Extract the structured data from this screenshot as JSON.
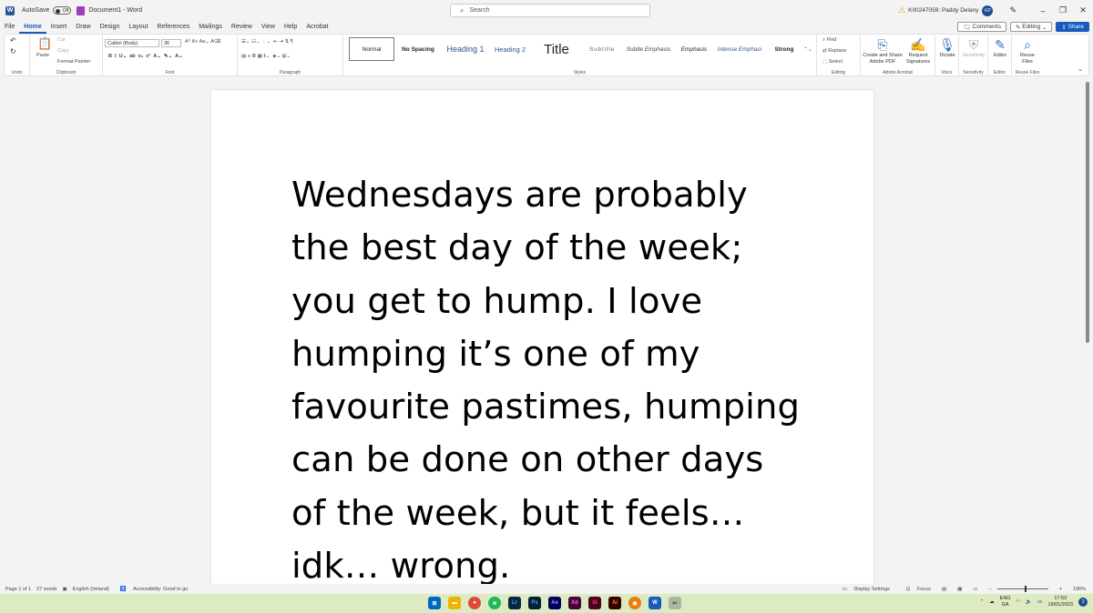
{
  "titlebar": {
    "app_logo": "W",
    "autosave_label": "AutoSave",
    "autosave_state": "Off",
    "doc_title": "Document1",
    "separator": "-",
    "app_name": "Word",
    "search_placeholder": "Search",
    "user": "K00247059: Paddy Delany",
    "avatar": "KP"
  },
  "menu": {
    "tabs": [
      "File",
      "Home",
      "Insert",
      "Draw",
      "Design",
      "Layout",
      "References",
      "Mailings",
      "Review",
      "View",
      "Help",
      "Acrobat"
    ],
    "active_tab": "Home",
    "comments": "Comments",
    "editing": "Editing",
    "share": "Share"
  },
  "ribbon": {
    "undo_label": "Undo",
    "clipboard": {
      "paste": "Paste",
      "cut": "Cut",
      "copy": "Copy",
      "format_painter": "Format Painter",
      "label": "Clipboard"
    },
    "font": {
      "family": "Calibri (Body)",
      "size": "36",
      "label": "Font"
    },
    "paragraph_label": "Paragraph",
    "styles": {
      "items": [
        "Normal",
        "No Spacing",
        "Heading 1",
        "Heading 2",
        "Title",
        "Subtitle",
        "Subtle Emphasis",
        "Emphasis",
        "Intense Emphasi",
        "Strong"
      ],
      "label": "Styles"
    },
    "editing": {
      "find": "Find",
      "replace": "Replace",
      "select": "Select",
      "label": "Editing"
    },
    "acrobat": {
      "create": "Create and Share Adobe PDF",
      "request": "Request Signatures",
      "label": "Adobe Acrobat"
    },
    "voice": {
      "dictate": "Dictate",
      "label": "Voice"
    },
    "sensitivity": {
      "btn": "Sensitivity",
      "label": "Sensitivity"
    },
    "editor": {
      "btn": "Editor",
      "label": "Editor"
    },
    "reuse": {
      "btn": "Reuse Files",
      "label": "Reuse Files"
    }
  },
  "document": {
    "body": "Wednesdays are probably the best day of the week; you get to hump. I love humping it’s one of my favourite pastimes, humping can be done on other days of the week, but it feels… idk… wrong."
  },
  "status": {
    "page": "Page 1 of 1",
    "words": "27 words",
    "language": "English (Ireland)",
    "accessibility": "Accessibility: Good to go",
    "display_settings": "Display Settings",
    "focus": "Focus",
    "zoom": "196%"
  },
  "taskbar": {
    "apps": [
      "Lr",
      "Ps",
      "Ae",
      "Xd",
      "Id",
      "Ai"
    ],
    "lang_top": "ENG",
    "lang_bottom": "GA",
    "time": "17:53",
    "date": "19/01/2023",
    "notifications": "3"
  },
  "colors": {
    "accent": "#185abd",
    "taskbar": "#dcebc2"
  }
}
